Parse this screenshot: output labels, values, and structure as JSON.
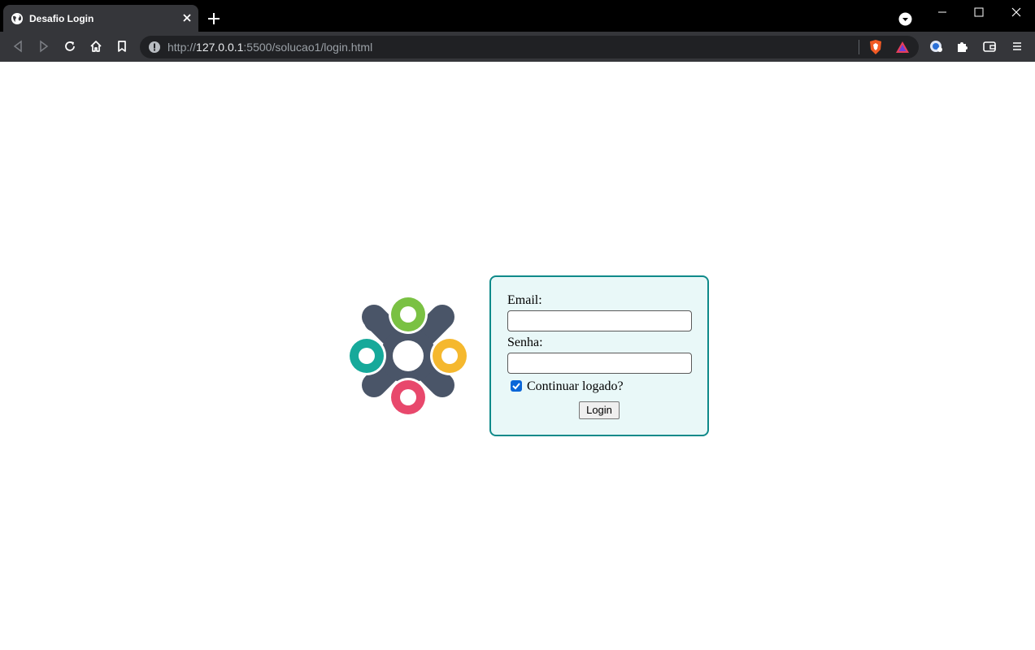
{
  "browser": {
    "tab": {
      "title": "Desafio Login"
    },
    "address_bar": {
      "scheme": "http://",
      "host": "127.0.0.1",
      "rest": ":5500/solucao1/login.html"
    }
  },
  "icons": {
    "tab_favicon": "globe-icon",
    "tab_close": "close-icon",
    "new_tab": "plus-icon",
    "back": "back-arrow-icon",
    "forward": "forward-arrow-icon",
    "reload": "reload-icon",
    "home": "home-icon",
    "bookmark": "bookmark-icon",
    "site_info": "info-icon",
    "shields": "brave-shield-icon",
    "rewards": "brave-rewards-icon",
    "extensions": "puzzle-icon",
    "wallet": "wallet-icon",
    "menu": "hamburger-menu-icon"
  },
  "colors": {
    "tabstrip": "#000000",
    "toolbar": "#35363a",
    "box_border": "#0f8a8a",
    "box_bg": "#e9f8f8",
    "logo_green": "#7ac143",
    "logo_teal": "#16a99a",
    "logo_yellow": "#f5b82e",
    "logo_pink": "#e8486c",
    "logo_body": "#4a5568"
  },
  "form": {
    "email_label": "Email:",
    "email_value": "",
    "password_label": "Senha:",
    "password_value": "",
    "remember_label": "Continuar logado?",
    "remember_checked": true,
    "submit_label": "Login"
  }
}
